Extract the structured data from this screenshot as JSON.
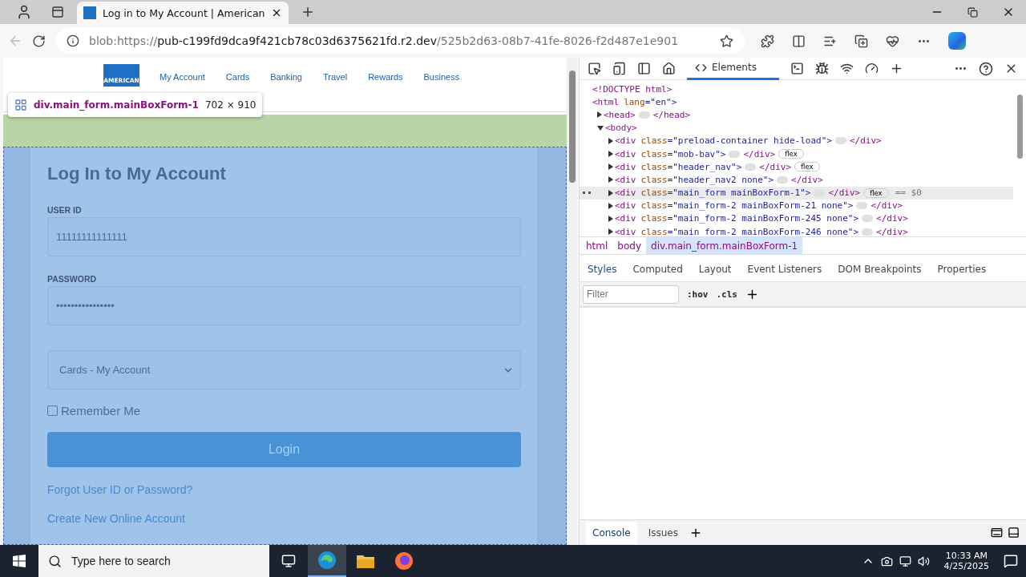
{
  "browser": {
    "tabs": [
      {
        "title": "Log in to My Account | American",
        "selected": true
      }
    ],
    "address": {
      "scheme": "blob:https://",
      "host": "pub-c199fd9dca9f421cb78c03d6375621fd.r2.dev",
      "path": "/525b2d63-08b7-41fe-8026-f2d487e1e901"
    }
  },
  "page": {
    "logo_text": "AMERICAN",
    "nav": [
      "My Account",
      "Cards",
      "Banking",
      "Travel",
      "Rewards",
      "Business"
    ],
    "inspect_tooltip": {
      "selector": "div.main_form.mainBoxForm-1",
      "size": "702 × 910"
    },
    "form": {
      "title": "Log In to My Account",
      "user_id": {
        "label": "USER ID",
        "value": "11111111111111"
      },
      "password": {
        "label": "PASSWORD",
        "value": "••••••••••••••••"
      },
      "account_type": {
        "value": "Cards - My Account"
      },
      "remember": {
        "label": "Remember Me",
        "checked": false
      },
      "login_button": "Login",
      "links": [
        "Forgot User ID or Password?",
        "Create New Online Account"
      ]
    }
  },
  "devtools": {
    "tabs": [
      {
        "label": "Elements",
        "selected": true
      }
    ],
    "dom": [
      {
        "tag": "<!DOCTYPE html>",
        "selected": false
      },
      {
        "tag": "<html",
        "attr": "lang",
        "value": "=\"en\">",
        "selected": false,
        "children": [
          {
            "tag": "<head>",
            "close": "</head>",
            "expanded": false,
            "selected": false
          },
          {
            "tag": "<body>",
            "expanded": true,
            "selected": false,
            "children": [
              {
                "tag": "<div",
                "attr": "class",
                "value": "=\"preload-container hide-load\">",
                "close": "</div>",
                "expanded": false,
                "selected": false
              },
              {
                "tag": "<div",
                "attr": "class",
                "value": "=\"mob-bav\">",
                "close": "</div>",
                "badge": "flex",
                "expanded": false,
                "selected": false
              },
              {
                "tag": "<div",
                "attr": "class",
                "value": "=\"header_nav\">",
                "close": "</div>",
                "badge": "flex",
                "expanded": false,
                "selected": false
              },
              {
                "tag": "<div",
                "attr": "class",
                "value": "=\"header_nav2 none\">",
                "close": "</div>",
                "expanded": false,
                "selected": false
              },
              {
                "tag": "<div",
                "attr": "class",
                "value": "=\"main_form mainBoxForm-1\">",
                "close": "</div>",
                "badge": "flex",
                "ref": "== $0",
                "expanded": false,
                "selected": true
              },
              {
                "tag": "<div",
                "attr": "class",
                "value": "=\"main_form-2 mainBoxForm-21 none\">",
                "close": "</div>",
                "expanded": false,
                "selected": false
              },
              {
                "tag": "<div",
                "attr": "class",
                "value": "=\"main_form-2 mainBoxForm-245 none\">",
                "close": "</div>",
                "expanded": false,
                "selected": false
              },
              {
                "tag": "<div",
                "attr": "class",
                "value": "=\"main_form-2 mainBoxForm-246 none\">",
                "close": "</div>",
                "expanded": false,
                "selected": false
              }
            ]
          }
        ]
      }
    ],
    "breadcrumbs": [
      {
        "label": "html",
        "selected": false
      },
      {
        "label": "body",
        "selected": false
      },
      {
        "label": "div.main_form.mainBoxForm-1",
        "selected": true
      }
    ],
    "pane_tabs": [
      {
        "label": "Styles",
        "selected": true
      },
      {
        "label": "Computed",
        "selected": false
      },
      {
        "label": "Layout",
        "selected": false
      },
      {
        "label": "Event Listeners",
        "selected": false
      },
      {
        "label": "DOM Breakpoints",
        "selected": false
      },
      {
        "label": "Properties",
        "selected": false
      }
    ],
    "filter": {
      "placeholder": "Filter"
    },
    "hov": ":hov",
    "cls": ".cls",
    "drawer_tabs": [
      {
        "label": "Console",
        "selected": true
      },
      {
        "label": "Issues",
        "selected": false
      }
    ]
  },
  "taskbar": {
    "search": {
      "placeholder": "Type here to search"
    },
    "time": "10:33 AM",
    "date": "4/25/2025"
  }
}
